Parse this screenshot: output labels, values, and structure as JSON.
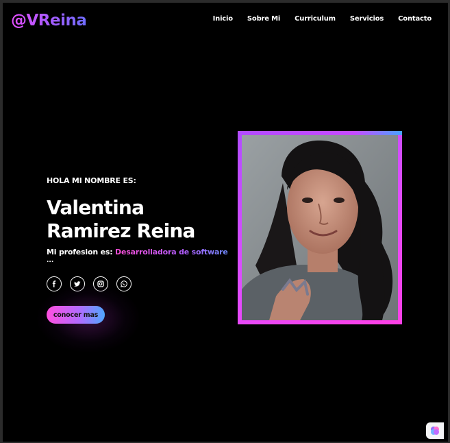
{
  "logo": "@VReina",
  "nav": [
    "Inicio",
    "Sobre Mi",
    "Curriculum",
    "Servicios",
    "Contacto"
  ],
  "hero": {
    "intro": "HOLA MI NOMBRE ES:",
    "name": "Valentina Ramirez Reina",
    "profession_label": "Mi profesion es: ",
    "profession_value": "Desarrolladora de software",
    "ellipsis": "...",
    "cta": "conocer mas"
  },
  "socials": [
    "facebook-icon",
    "twitter-icon",
    "instagram-icon",
    "whatsapp-icon"
  ],
  "colors": {
    "background": "#000000",
    "accent_pink": "#ff4fe0",
    "accent_purple": "#b35cff",
    "accent_blue": "#4fa6ff"
  }
}
